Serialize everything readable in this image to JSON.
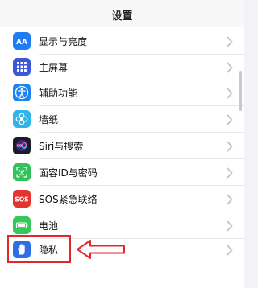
{
  "header": {
    "title": "设置"
  },
  "rows": [
    {
      "id": "display",
      "label": "显示与亮度",
      "icon": "display-brightness-icon",
      "color": "#1f7cf2"
    },
    {
      "id": "home",
      "label": "主屏幕",
      "icon": "home-screen-icon",
      "color": "#3c57d8"
    },
    {
      "id": "accessibility",
      "label": "辅助功能",
      "icon": "accessibility-icon",
      "color": "#1a85f0"
    },
    {
      "id": "wallpaper",
      "label": "墙纸",
      "icon": "wallpaper-icon",
      "color": "#31b4e8"
    },
    {
      "id": "siri",
      "label": "Siri与搜索",
      "icon": "siri-icon",
      "color": "#1b1b2a"
    },
    {
      "id": "faceid",
      "label": "面容ID与密码",
      "icon": "face-id-icon",
      "color": "#32c15a"
    },
    {
      "id": "sos",
      "label": "SOS紧急联络",
      "icon": "sos-icon",
      "color": "#e3342f"
    },
    {
      "id": "battery",
      "label": "电池",
      "icon": "battery-icon",
      "color": "#35c759"
    },
    {
      "id": "privacy",
      "label": "隐私",
      "icon": "privacy-hand-icon",
      "color": "#2f6fe6"
    }
  ],
  "sos_icon_text": "SOS",
  "display_icon_text": "AA",
  "annotation": {
    "color": "#e0292d"
  }
}
